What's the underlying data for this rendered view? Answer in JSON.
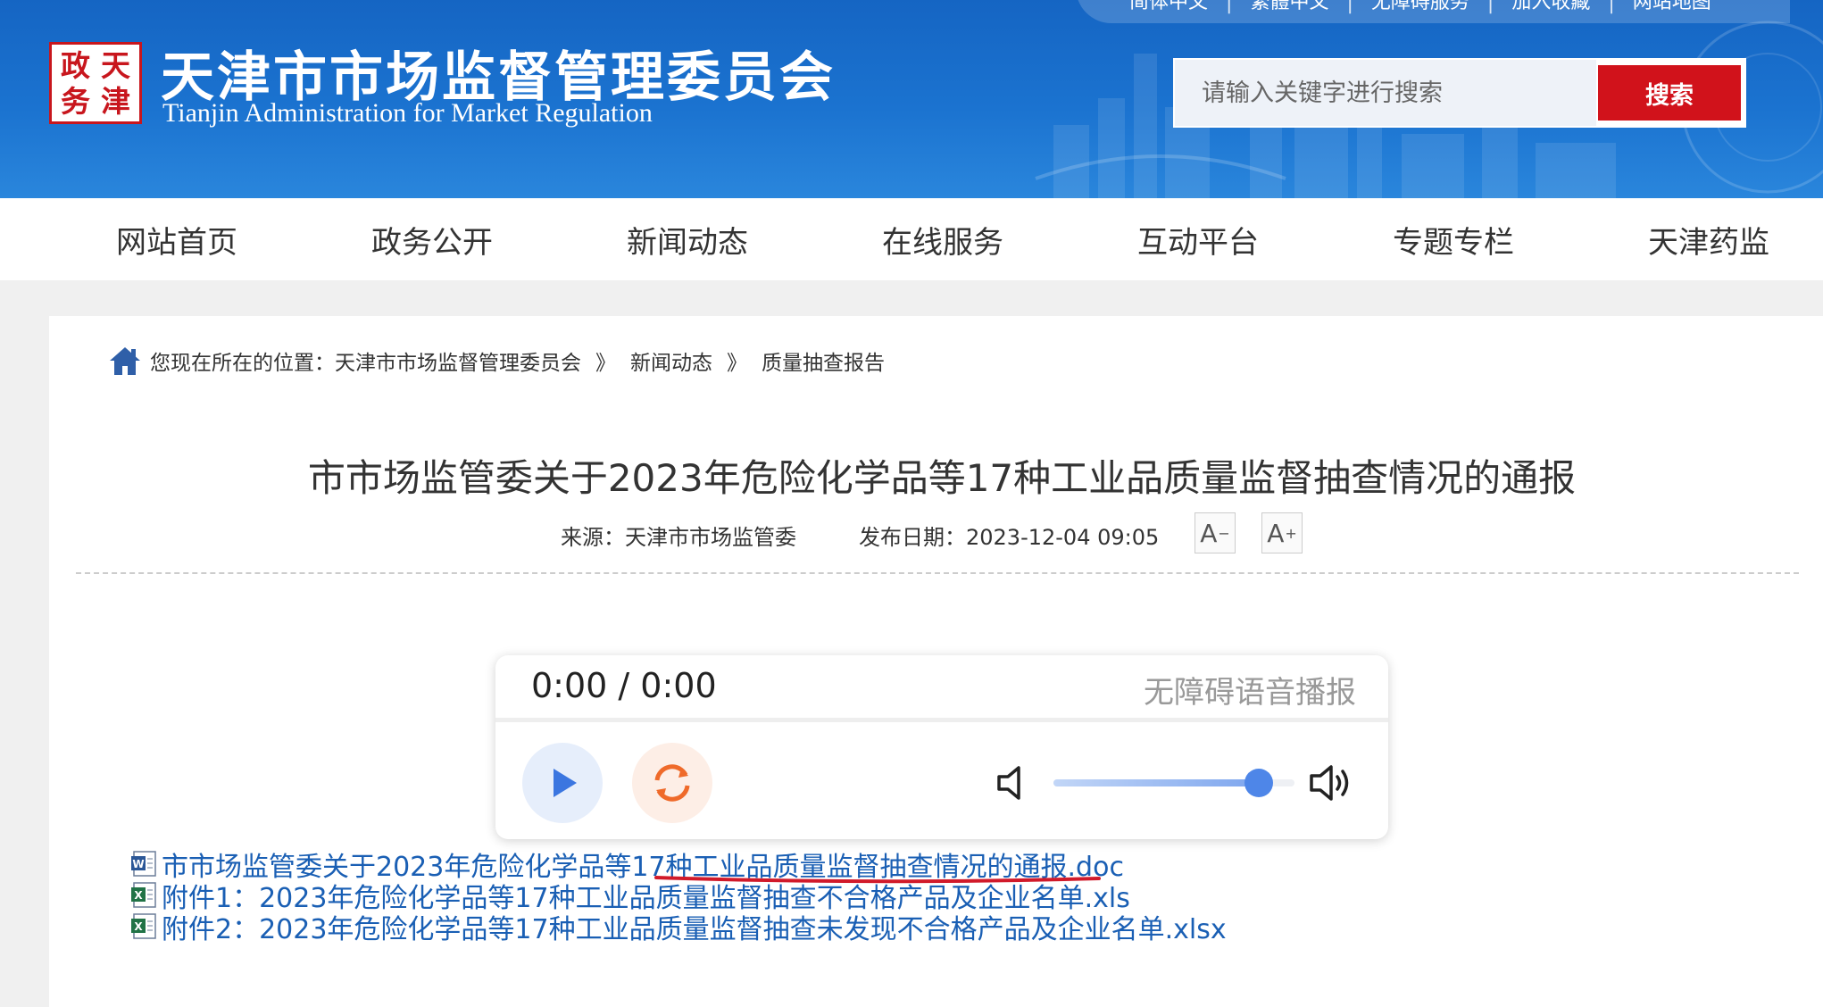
{
  "header": {
    "seal_chars": [
      "天",
      "津",
      "政",
      "务"
    ],
    "site_title": "天津市市场监督管理委员会",
    "site_subtitle": "Tianjin Administration for Market Regulation",
    "top_links": [
      "简体中文",
      "繁體中文",
      "无障碍服务",
      "加入收藏",
      "网站地图"
    ],
    "search_placeholder": "请输入关键字进行搜索",
    "search_button": "搜索",
    "brand_blue": "#1565c3",
    "accent_red": "#d1121b"
  },
  "nav": {
    "items": [
      "网站首页",
      "政务公开",
      "新闻动态",
      "在线服务",
      "互动平台",
      "专题专栏",
      "天津药监"
    ]
  },
  "breadcrumb": {
    "prefix": "您现在所在的位置：",
    "items": [
      "天津市市场监督管理委员会",
      "新闻动态",
      "质量抽查报告"
    ],
    "separator": "》"
  },
  "article": {
    "title": "市市场监管委关于2023年危险化学品等17种工业品质量监督抽查情况的通报",
    "source": "来源：天津市市场监管委",
    "date": "发布日期：2023-12-04 09:05",
    "font_decrease": "A",
    "font_increase": "A"
  },
  "player": {
    "time": "0:00 / 0:00",
    "label": "无障碍语音播报",
    "volume_fraction": 0.85
  },
  "attachments": [
    {
      "icon": "word-doc-icon",
      "text": "市市场监管委关于2023年危险化学品等17种工业品质量监督抽查情况的通报.doc"
    },
    {
      "icon": "excel-xls-icon",
      "text": "附件1：2023年危险化学品等17种工业品质量监督抽查不合格产品及企业名单.xls"
    },
    {
      "icon": "excel-xls-icon",
      "text": "附件2：2023年危险化学品等17种工业品质量监督抽查未发现不合格产品及企业名单.xlsx"
    }
  ]
}
